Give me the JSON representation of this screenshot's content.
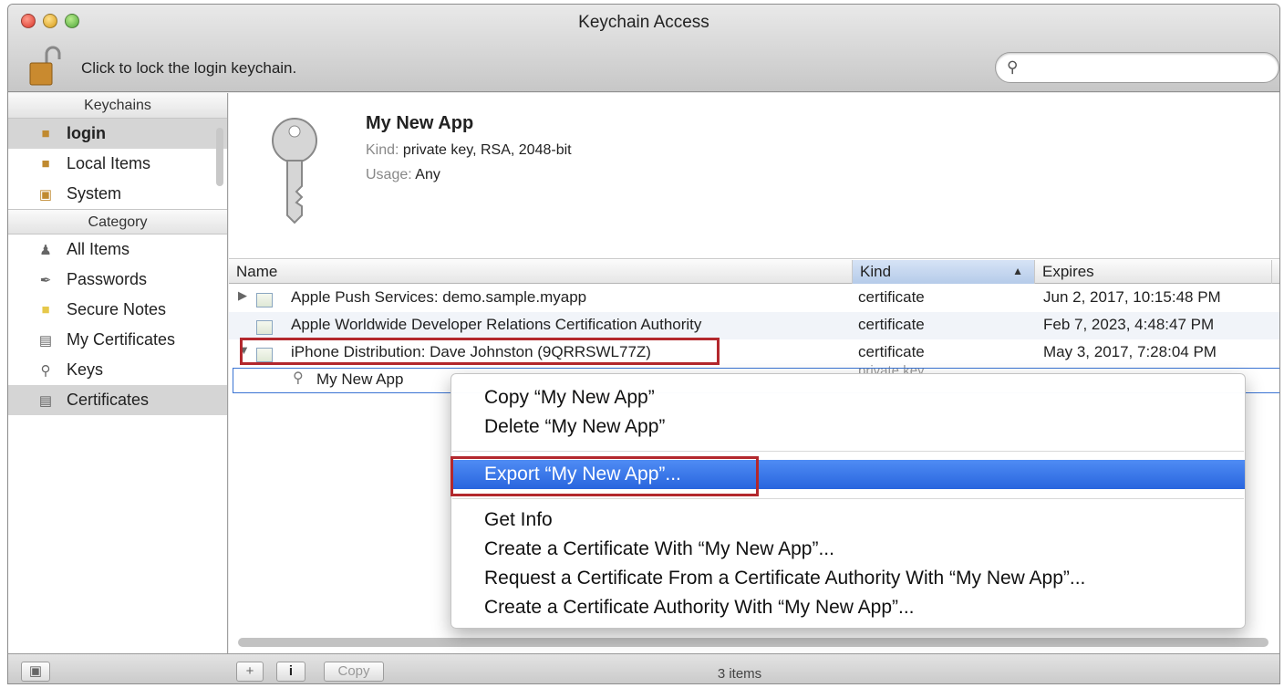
{
  "window": {
    "title": "Keychain Access"
  },
  "toolbar": {
    "lock_message": "Click to lock the login keychain.",
    "search_placeholder": ""
  },
  "sidebar": {
    "keychains_header": "Keychains",
    "keychains": [
      {
        "label": "login",
        "selected": true
      },
      {
        "label": "Local Items"
      },
      {
        "label": "System"
      }
    ],
    "category_header": "Category",
    "categories": [
      {
        "label": "All Items"
      },
      {
        "label": "Passwords"
      },
      {
        "label": "Secure Notes"
      },
      {
        "label": "My Certificates"
      },
      {
        "label": "Keys"
      },
      {
        "label": "Certificates",
        "selected": true
      }
    ]
  },
  "detail": {
    "name": "My New App",
    "kind_label": "Kind:",
    "kind_value": "private key, RSA, 2048-bit",
    "usage_label": "Usage:",
    "usage_value": "Any"
  },
  "table": {
    "columns": {
      "name": "Name",
      "kind": "Kind",
      "expires": "Expires"
    },
    "rows": [
      {
        "name": "Apple Push Services: demo.sample.myapp",
        "kind": "certificate",
        "expires": "Jun 2, 2017, 10:15:48 PM"
      },
      {
        "name": "Apple Worldwide Developer Relations Certification Authority",
        "kind": "certificate",
        "expires": "Feb 7, 2023, 4:48:47 PM"
      },
      {
        "name": "iPhone Distribution: Dave Johnston (9QRRSWL77Z)",
        "kind": "certificate",
        "expires": "May 3, 2017, 7:28:04 PM"
      },
      {
        "name": "My New App",
        "kind": "private key",
        "expires": ""
      }
    ]
  },
  "context_menu": {
    "items": [
      "Copy “My New App”",
      "Delete “My New App”",
      "Export “My New App”...",
      "Get Info",
      "Create a Certificate With “My New App”...",
      "Request a Certificate From a Certificate Authority With “My New App”...",
      "Create a Certificate Authority With “My New App”..."
    ],
    "highlighted_index": 2
  },
  "bottom_bar": {
    "add": "+",
    "info": "i",
    "copy": "Copy",
    "count": "3 items"
  },
  "colors": {
    "highlight": "#3a78e8",
    "annotation": "#b3282d"
  }
}
